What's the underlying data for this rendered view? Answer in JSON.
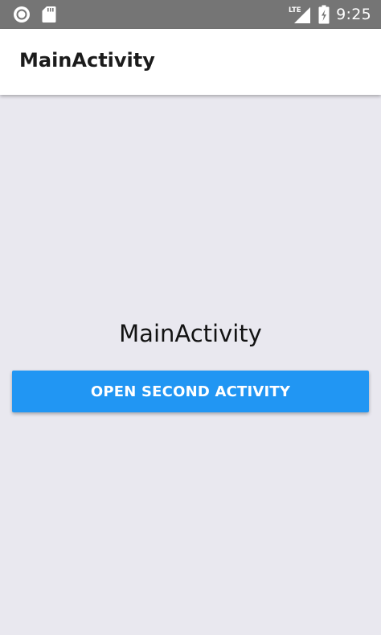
{
  "status_bar": {
    "time": "9:25",
    "network_label": "LTE",
    "icons": [
      "circle-notification-icon",
      "sd-card-icon",
      "cell-signal-icon",
      "battery-charging-icon"
    ]
  },
  "app_bar": {
    "title": "MainActivity"
  },
  "main": {
    "label": "MainActivity",
    "button_label": "OPEN SECOND ACTIVITY"
  },
  "colors": {
    "status_bar": "#757575",
    "app_bar": "#ffffff",
    "background": "#e9e8ef",
    "button": "#2196f3",
    "button_text": "#ffffff"
  }
}
